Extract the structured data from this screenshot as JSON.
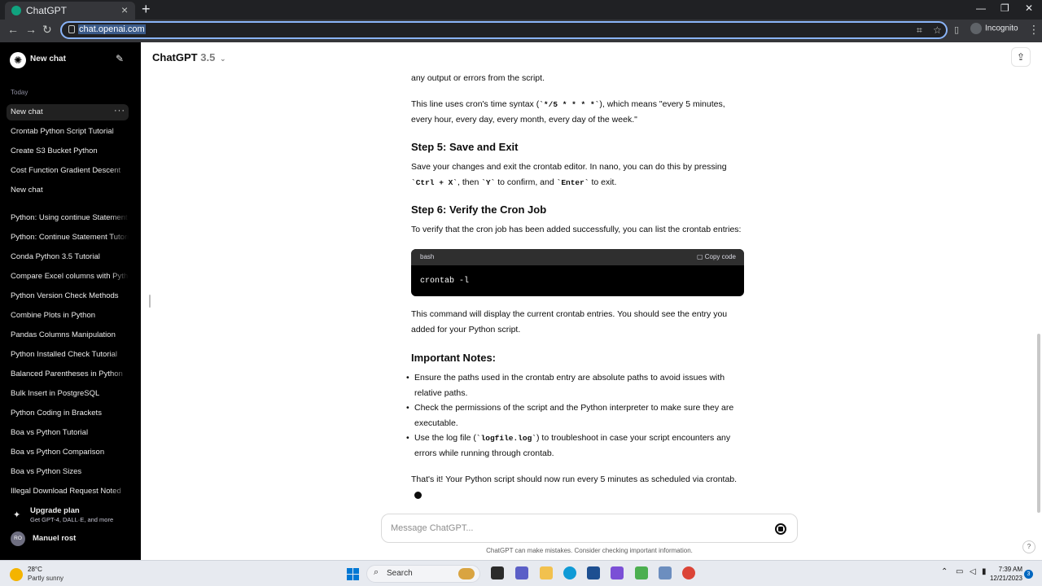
{
  "browser": {
    "tab_title": "ChatGPT",
    "url": "chat.openai.com",
    "profile_label": "Incognito"
  },
  "sidebar": {
    "new_chat_label": "New chat",
    "section_today": "Today",
    "items": [
      "New chat",
      "Crontab Python Script Tutorial",
      "Create S3 Bucket Python",
      "Cost Function Gradient Descent",
      "New chat",
      "Python: Using continue Statement",
      "Python: Continue Statement Tutorial",
      "Conda Python 3.5 Tutorial",
      "Compare Excel columns with Python",
      "Python Version Check Methods",
      "Combine Plots in Python",
      "Pandas Columns Manipulation",
      "Python Installed Check Tutorial",
      "Balanced Parentheses in Python",
      "Bulk Insert in PostgreSQL",
      "Python Coding in Brackets",
      "Boa vs Python Tutorial",
      "Boa vs Python Comparison",
      "Boa vs Python Sizes",
      "Illegal Download Request Noted"
    ],
    "upgrade_title": "Upgrade plan",
    "upgrade_sub": "Get GPT-4, DALL·E, and more",
    "user_initials": "RO",
    "user_name": "Manuel rost"
  },
  "header": {
    "model_name": "ChatGPT",
    "model_version": "3.5"
  },
  "message": {
    "p0": "any output or errors from the script.",
    "p1_a": "This line uses cron's time syntax (",
    "p1_code": "`*/5 * * * *`",
    "p1_b": "), which means \"every 5 minutes, every hour, every day, every month, every day of the week.\"",
    "h_step5": "Step 5: Save and Exit",
    "p2_a": "Save your changes and exit the crontab editor. In nano, you can do this by pressing ",
    "p2_code1": "`Ctrl + X`",
    "p2_b": ", then ",
    "p2_code2": "`Y`",
    "p2_c": " to confirm, and ",
    "p2_code3": "`Enter`",
    "p2_d": " to exit.",
    "h_step6": "Step 6: Verify the Cron Job",
    "p3": "To verify that the cron job has been added successfully, you can list the crontab entries:",
    "code_lang": "bash",
    "copy_label": "Copy code",
    "code": "crontab -l",
    "p4": "This command will display the current crontab entries. You should see the entry you added for your Python script.",
    "h_notes": "Important Notes:",
    "note1": "Ensure the paths used in the crontab entry are absolute paths to avoid issues with relative paths.",
    "note2": "Check the permissions of the script and the Python interpreter to make sure they are executable.",
    "note3_a": "Use the log file (",
    "note3_code": "`logfile.log`",
    "note3_b": ") to troubleshoot in case your script encounters any errors while running through crontab.",
    "p5": "That's it! Your Python script should now run every 5 minutes as scheduled via crontab."
  },
  "composer": {
    "placeholder": "Message ChatGPT...",
    "disclaimer": "ChatGPT can make mistakes. Consider checking important information.",
    "help": "?"
  },
  "taskbar": {
    "temp": "28°C",
    "weather": "Partly sunny",
    "search_label": "Search",
    "time": "7:39 AM",
    "date": "12/21/2023",
    "notifications": "3"
  }
}
